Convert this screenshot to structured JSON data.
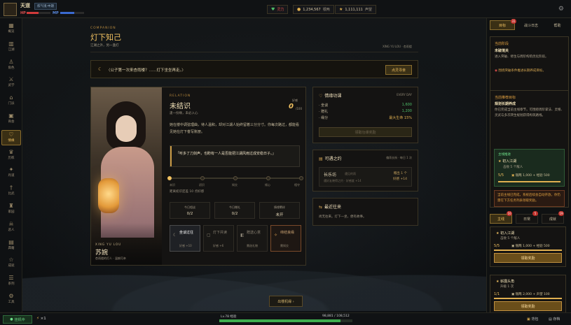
{
  "colors": {
    "accent": "#f0c060",
    "hp": "#d03a3a",
    "mp": "#3a6ad0",
    "exp": "#3fae4f",
    "panel_border": "#3a3424"
  },
  "header": {
    "game_name": "天道",
    "realm": "炼气境·中期",
    "hp_label": "HP",
    "mp_label": "MP",
    "hp_fraction": 0.5,
    "mp_fraction": 0.6,
    "resources": [
      {
        "icon": "heart-icon",
        "glyph": "♥",
        "value": "灵力"
      },
      {
        "icon": "coin-icon",
        "glyph": "●",
        "value": "1,234,567",
        "unit": "银两"
      },
      {
        "icon": "star-icon",
        "glyph": "★",
        "value": "1,111,111",
        "unit": "声望"
      }
    ]
  },
  "nav": [
    {
      "icon": "grid-icon",
      "glyph": "▦",
      "label": "概览"
    },
    {
      "icon": "map-icon",
      "glyph": "▥",
      "label": "江湖"
    },
    {
      "icon": "person-icon",
      "glyph": "♙",
      "label": "角色"
    },
    {
      "icon": "swords-icon",
      "glyph": "⚔",
      "label": "武学"
    },
    {
      "icon": "gate-icon",
      "glyph": "⌂",
      "label": "门派"
    },
    {
      "icon": "shop-icon",
      "glyph": "▣",
      "label": "商会"
    },
    {
      "icon": "heart-icon",
      "glyph": "♡",
      "label": "情缘",
      "active": true
    },
    {
      "icon": "trophy-icon",
      "glyph": "♛",
      "label": "历练"
    },
    {
      "icon": "gourd-icon",
      "glyph": "✦",
      "label": "丹道"
    },
    {
      "icon": "sword-icon",
      "glyph": "†",
      "label": "比武"
    },
    {
      "icon": "pavilion-icon",
      "glyph": "♜",
      "label": "家园"
    },
    {
      "icon": "skull-icon",
      "glyph": "☠",
      "label": "恶人"
    },
    {
      "icon": "book-icon",
      "glyph": "▤",
      "label": "典籍"
    },
    {
      "icon": "star-icon",
      "glyph": "☆",
      "label": "成就"
    },
    {
      "icon": "scroll-icon",
      "glyph": "☰",
      "label": "系列"
    },
    {
      "icon": "wrench-icon",
      "glyph": "⚙",
      "label": "工具"
    }
  ],
  "main": {
    "section_en": "COMPANION",
    "title": "灯下知己",
    "subtitle": "江湖之外，另一盏灯",
    "right_tag": "XING YU LOU · 杏雨楼",
    "quote": "〈公子第一次来杏雨楼？……灯下坐坐再走。〉",
    "quote_button": "点灵寻亲"
  },
  "companion": {
    "en": "XING YU LOU",
    "name": "苏婉",
    "desc": "杏雨楼的灯人 · 温婉可亲",
    "relation_en": "RELATION",
    "relation": "未结识",
    "relation_sub": "逢一份缘，未必入心",
    "favor_label": "好感",
    "favor": "0",
    "favor_max": "/100",
    "description": "她在楼中调弦理曲，待人温和，却对江湖人始终留着三分分寸。你每次路过，都能看见她在灯下誊写账册。",
    "dialogue": "「听多了刀剑声，也盼有一人是否能把江湖风雨过成安稳日子。」",
    "stage_progress": 0.0,
    "stages": [
      "未识",
      "初识",
      "知交",
      "倾心",
      "相守"
    ],
    "next_hint": "距离初识还差 10 点好感",
    "stats": [
      {
        "label": "今日相谈",
        "value": "0/2"
      },
      {
        "label": "今日赠礼",
        "value": "0/2"
      },
      {
        "label": "情缘羁绊",
        "value": "未开"
      }
    ],
    "actions": [
      {
        "icon": "moon-icon",
        "glyph": "☾",
        "title": "坐谈过往",
        "sub": "好感 +10",
        "style": "primary"
      },
      {
        "icon": "box-icon",
        "glyph": "▢",
        "title": "灯下共读",
        "sub": "好感 +6",
        "style": "dim"
      },
      {
        "icon": "gift-icon",
        "glyph": "◧",
        "title": "赠送心意",
        "sub": "需选礼物",
        "style": "dim"
      },
      {
        "icon": "spark-icon",
        "glyph": "✧",
        "title": "缔结良缘",
        "sub": "需知交",
        "style": "special"
      }
    ]
  },
  "daily": {
    "title": "情缘功课",
    "tag": "EVERY DAY",
    "rows": [
      {
        "k": "· 坐谈",
        "v": "1,600",
        "color": "#4fc06a"
      },
      {
        "k": "· 赠礼",
        "v": "1,200",
        "color": "#4fc06a"
      },
      {
        "k": "· 缘分",
        "v": "最大生命 15%",
        "color": "#e0b050"
      }
    ],
    "button": "领取功课奖励"
  },
  "destination": {
    "title": "可遇之约",
    "tag": "偏雨长街 · 每日 1 次",
    "place": "长乐坊",
    "place_small": "遇见的雨",
    "place_desc": "遇好友晓得之约 · 好感度 +14",
    "stats": [
      "赠出 1 个",
      "好感 +14"
    ]
  },
  "recent": {
    "title": "最近往来",
    "desc": "尚无往来。灯下一坐，便有故事。"
  },
  "embark_button": "出楼机缘 ›",
  "bottom": {
    "afk": "挂机中",
    "speed": "×1",
    "exp_label": "Lv.78 经验",
    "exp_value": "98,881 / 108,512",
    "exp_fraction": 0.911,
    "bag": "背包",
    "save": "存档"
  },
  "right": {
    "tabs": [
      {
        "label": "目标",
        "badge": "31",
        "active": true
      },
      {
        "label": "战斗日志"
      },
      {
        "label": "帮助"
      }
    ],
    "stage_box": {
      "title": "当前阶段",
      "stage": "未破境关",
      "desc": "进入突破、修生与周阶构筑优化阶段。",
      "tip": "围绕突破条件推进长期养成目标。"
    },
    "goal_box": {
      "title": "当前推荐目标",
      "goal": "规划长期养成",
      "desc": "你已完成当前主线章节，可围绕周阶掌法、灵根、灵武与多次转生规划获得构筑路线。",
      "sub_title": "主线推进",
      "sub_quest": "初入江湖",
      "sub_desc": "击败 5 个敌人",
      "sub_prog": "5/5",
      "sub_rew": "银两 1,000 + 经验 500",
      "alert": "当前主线已完成，系统后续会自动开放，你仍需在下方任务列表领取奖励。"
    },
    "quest_tabs": [
      {
        "label": "主线",
        "badge": "10",
        "active": true
      },
      {
        "label": "日常",
        "badge": "5"
      },
      {
        "label": "成就",
        "badge": "19"
      }
    ],
    "quests": [
      {
        "title": "初入江湖",
        "desc": "击败 5 个敌人",
        "prog": "5/5",
        "rew": "银两 1,000 + 经验 500",
        "fraction": 1.0,
        "button": "领取奖励"
      },
      {
        "title": "崭露头角",
        "desc": "升级 1 次",
        "prog": "1/1",
        "rew": "银两 2,000 + 声望 100",
        "fraction": 1.0,
        "button": "领取奖励"
      }
    ]
  }
}
